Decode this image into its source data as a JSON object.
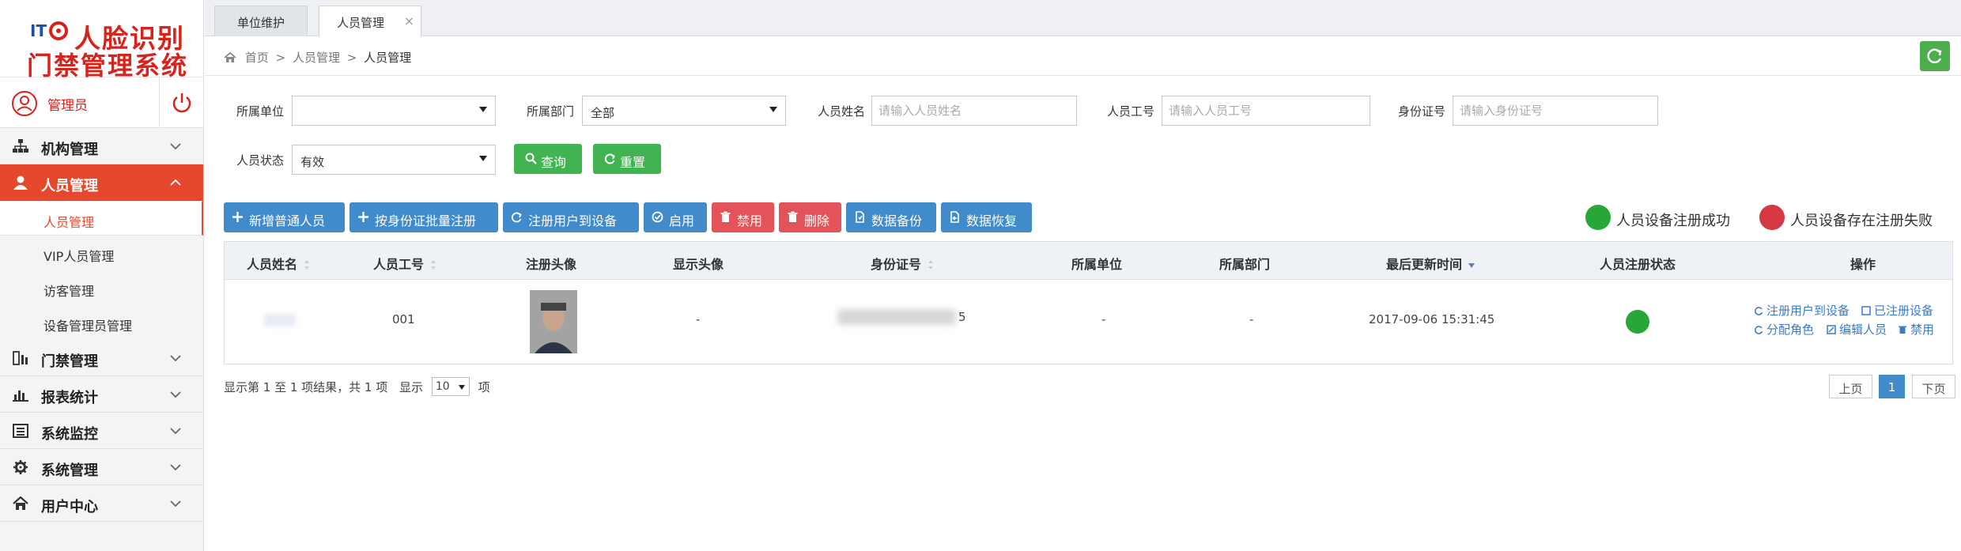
{
  "brand": {
    "badge_text": "ITO",
    "line1": "人脸识别",
    "line2": "门禁管理系统"
  },
  "user": {
    "name": "管理员"
  },
  "nav": [
    {
      "label": "机构管理",
      "icon": "org-chart-icon",
      "expanded": false
    },
    {
      "label": "人员管理",
      "icon": "person-icon",
      "expanded": true,
      "children": [
        "人员管理",
        "VIP人员管理",
        "访客管理",
        "设备管理员管理"
      ],
      "current": "人员管理"
    },
    {
      "label": "门禁管理",
      "icon": "door-icon",
      "expanded": false
    },
    {
      "label": "报表统计",
      "icon": "bar-chart-icon",
      "expanded": false
    },
    {
      "label": "系统监控",
      "icon": "monitor-icon",
      "expanded": false
    },
    {
      "label": "系统管理",
      "icon": "gear-icon",
      "expanded": false
    },
    {
      "label": "用户中心",
      "icon": "home-icon",
      "expanded": false
    }
  ],
  "tabs": [
    {
      "label": "单位维护",
      "active": false
    },
    {
      "label": "人员管理",
      "active": true,
      "close": "×"
    }
  ],
  "breadcrumb": {
    "home": "首页",
    "sep": ">",
    "parent": "人员管理",
    "current": "人员管理"
  },
  "filters": {
    "unit_label": "所属单位",
    "unit_value": "",
    "dept_label": "所属部门",
    "dept_value": "全部",
    "name_label": "人员姓名",
    "name_placeholder": "请输入人员姓名",
    "empno_label": "人员工号",
    "empno_placeholder": "请输入人员工号",
    "idcard_label": "身份证号",
    "idcard_placeholder": "请输入身份证号",
    "status_label": "人员状态",
    "status_value": "有效",
    "search_label": "查询",
    "reset_label": "重置"
  },
  "toolbar": {
    "add": "新增普通人员",
    "batch": "按身份证批量注册",
    "register": "注册用户到设备",
    "enable": "启用",
    "disable": "禁用",
    "delete": "删除",
    "backup": "数据备份",
    "restore": "数据恢复"
  },
  "legend": {
    "success": "人员设备注册成功",
    "fail": "人员设备存在注册失败",
    "success_color": "#27a737",
    "fail_color": "#d63843"
  },
  "table": {
    "headers": [
      "人员姓名",
      "人员工号",
      "注册头像",
      "显示头像",
      "身份证号",
      "所属单位",
      "所属部门",
      "最后更新时间",
      "人员注册状态",
      "操作"
    ],
    "rows": [
      {
        "empno": "001",
        "display_photo": "-",
        "idcard_tail": "5",
        "unit": "-",
        "dept": "-",
        "updated": "2017-09-06 15:31:45",
        "ops": [
          "注册用户到设备",
          "已注册设备",
          "分配角色",
          "编辑人员",
          "禁用"
        ]
      }
    ]
  },
  "footer": {
    "info_prefix": "显示第 1 至 1 项结果，共 1 项",
    "show_label": "显示",
    "page_len": "10",
    "unit": "项",
    "prev": "上页",
    "page": "1",
    "next": "下页"
  }
}
